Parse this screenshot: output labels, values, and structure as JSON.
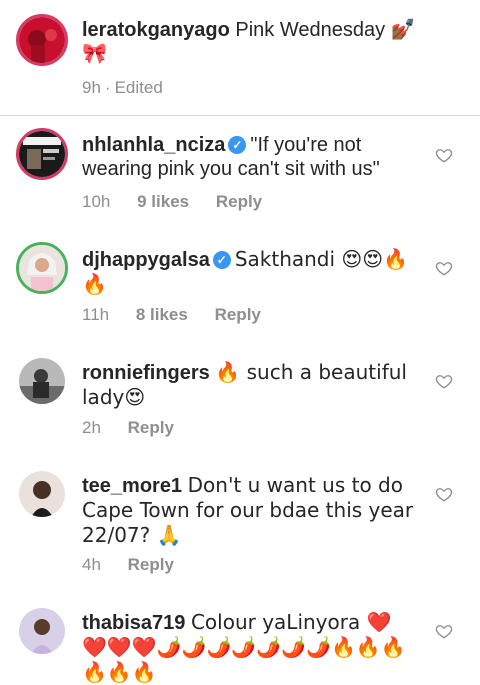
{
  "caption": {
    "username": "leratokganyago",
    "text": "Pink Wednesday 💅🏾🎀",
    "time": "9h",
    "edited": "Edited"
  },
  "comments": [
    {
      "username": "nhlanhla_nciza",
      "verified": true,
      "text": "\"If you're not wearing pink you can't sit with us\"",
      "time": "10h",
      "likes": "9 likes",
      "reply": "Reply"
    },
    {
      "username": "djhappygalsa",
      "verified": true,
      "text": "Sakthandi 😍😍🔥🔥",
      "time": "11h",
      "likes": "8 likes",
      "reply": "Reply"
    },
    {
      "username": "ronniefingers",
      "verified": false,
      "text": "🔥 such a beautiful lady😍",
      "time": "2h",
      "reply": "Reply"
    },
    {
      "username": "tee_more1",
      "verified": false,
      "text": "Don't u want us to do Cape Town for our bdae this year 22/07? 🙏",
      "time": "4h",
      "reply": "Reply"
    },
    {
      "username": "thabisa719",
      "verified": false,
      "text": "Colour yaLinyora ❤️❤️❤️❤️🌶️🌶️🌶️🌶️🌶️🌶️🌶️🔥🔥🔥🔥🔥🔥",
      "time": "",
      "reply": ""
    }
  ],
  "colors": {
    "verified": "#3897f0",
    "meta": "#8e8e8e",
    "divider": "#dbdbdb"
  },
  "icons": [
    "heart-outline-icon",
    "verified-badge-icon"
  ]
}
